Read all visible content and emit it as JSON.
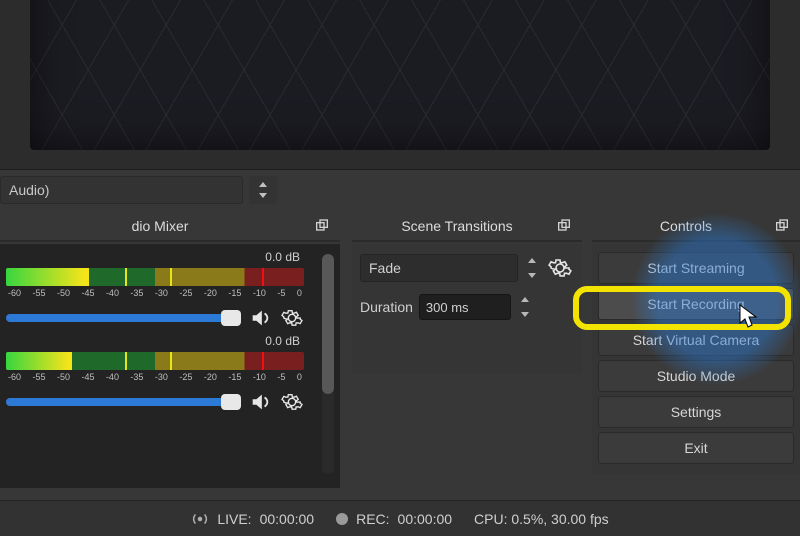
{
  "audio_select": {
    "label": "Audio)"
  },
  "panels": {
    "mixer": {
      "title": "dio Mixer"
    },
    "transitions": {
      "title": "Scene Transitions"
    },
    "controls": {
      "title": "Controls"
    }
  },
  "mixer": {
    "ticks": [
      "-60",
      "-55",
      "-50",
      "-45",
      "-40",
      "-35",
      "-30",
      "-25",
      "-20",
      "-15",
      "-10",
      "-5",
      "0"
    ],
    "channels": [
      {
        "db": "0.0 dB",
        "fill_pct": 96
      },
      {
        "db": "0.0 dB",
        "fill_pct": 96
      }
    ]
  },
  "transitions": {
    "select": "Fade",
    "duration_label": "Duration",
    "duration_value": "300 ms"
  },
  "controls": {
    "items": [
      "Start Streaming",
      "Start Recording",
      "Start Virtual Camera",
      "Studio Mode",
      "Settings",
      "Exit"
    ]
  },
  "status": {
    "live_label": "LIVE:",
    "live_time": "00:00:00",
    "rec_label": "REC:",
    "rec_time": "00:00:00",
    "cpu": "CPU: 0.5%, 30.00 fps"
  }
}
